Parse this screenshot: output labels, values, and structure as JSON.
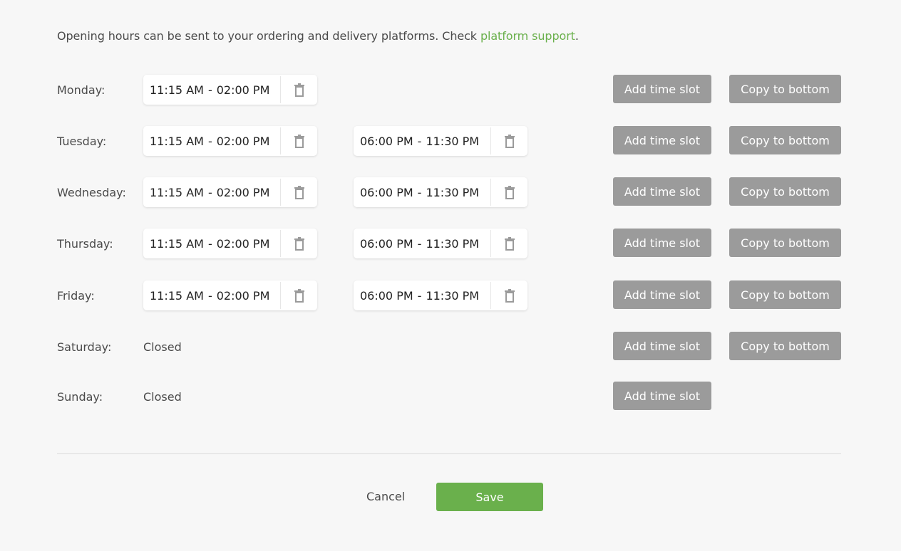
{
  "intro": {
    "text": "Opening hours can be sent to your ordering and delivery platforms. Check ",
    "link": "platform support",
    "suffix": "."
  },
  "days": [
    {
      "label": "Monday:",
      "slots": [
        {
          "start": "11:15 AM",
          "end": "02:00 PM"
        }
      ]
    },
    {
      "label": "Tuesday:",
      "slots": [
        {
          "start": "11:15 AM",
          "end": "02:00 PM"
        },
        {
          "start": "06:00 PM",
          "end": "11:30 PM"
        }
      ]
    },
    {
      "label": "Wednesday:",
      "slots": [
        {
          "start": "11:15 AM",
          "end": "02:00 PM"
        },
        {
          "start": "06:00 PM",
          "end": "11:30 PM"
        }
      ]
    },
    {
      "label": "Thursday:",
      "slots": [
        {
          "start": "11:15 AM",
          "end": "02:00 PM"
        },
        {
          "start": "06:00 PM",
          "end": "11:30 PM"
        }
      ]
    },
    {
      "label": "Friday:",
      "slots": [
        {
          "start": "11:15 AM",
          "end": "02:00 PM"
        },
        {
          "start": "06:00 PM",
          "end": "11:30 PM"
        }
      ]
    },
    {
      "label": "Saturday:",
      "closed": "Closed",
      "slots": []
    },
    {
      "label": "Sunday:",
      "closed": "Closed",
      "slots": []
    }
  ],
  "separator": "-",
  "buttons": {
    "add_slot": "Add time slot",
    "copy": "Copy to bottom",
    "cancel": "Cancel",
    "save": "Save"
  },
  "icons": {
    "delete": "trash-icon"
  },
  "colors": {
    "accent": "#6ab04c",
    "button_gray": "#9b9b9b",
    "background": "#f7f7f7"
  }
}
